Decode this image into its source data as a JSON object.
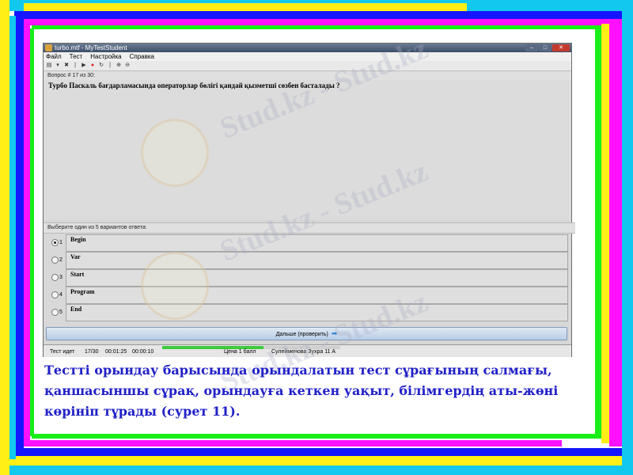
{
  "window": {
    "title": "turbo.mtf - MyTestStudent",
    "buttons": [
      "–",
      "□",
      "✕"
    ]
  },
  "menu": [
    "Файл",
    "Тест",
    "Настройка",
    "Справка"
  ],
  "question": {
    "header": "Вопрос # 17 из 30:",
    "text": "Турбо Паскаль бағдарламасында операторлар бөлігі қандай қызметші сөзбен басталады ?"
  },
  "answers": {
    "header": "Выберите один из 5 вариантов ответа:",
    "options": [
      {
        "num": "1",
        "label": "Begin",
        "selected": true
      },
      {
        "num": "2",
        "label": "Var",
        "selected": false
      },
      {
        "num": "3",
        "label": "Start",
        "selected": false
      },
      {
        "num": "4",
        "label": "Program",
        "selected": false
      },
      {
        "num": "5",
        "label": "End",
        "selected": false
      }
    ]
  },
  "next_button": {
    "label": "Дальше (проверить)"
  },
  "status": {
    "state": "Тест идет",
    "progress_text": "17/30",
    "elapsed": "00:01:25",
    "limit": "00:00:10",
    "progress_fraction": 0.57,
    "score": "Цена 1 балл",
    "student": "Сулейменова Зухра 11 А"
  },
  "watermark": "Stud.kz - Stud.kz",
  "caption": "Тестті орындау барысында орындалатын тест сұрағының салмағы, қаншасыншы сұрақ, орындауға кеткен уақыт, білімгердің аты-жөні көрініп тұрады (сурет 11).",
  "colors": {
    "caption": "#2121c8",
    "frame_blue": "#1515ff",
    "frame_magenta": "#ff10ff",
    "frame_cyan": "#12c8ef",
    "frame_yellow": "#ffef16",
    "frame_green": "#18ee18"
  }
}
